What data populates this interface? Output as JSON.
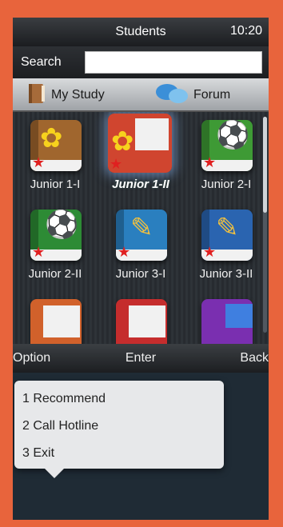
{
  "status": {
    "title": "Students",
    "time": "10:20"
  },
  "search": {
    "label": "Search",
    "value": ""
  },
  "tabs": [
    {
      "label": "My Study",
      "icon": "book-icon"
    },
    {
      "label": "Forum",
      "icon": "chat-bubbles-icon"
    }
  ],
  "courses": [
    {
      "label": "Junior 1-I",
      "icon": "flower-icon",
      "color": "#a0662e"
    },
    {
      "label": "Junior 1-II",
      "icon": "flower-notebook-icon",
      "color": "#d0452f",
      "selected": true
    },
    {
      "label": "Junior 2-I",
      "icon": "soccer-ball-icon",
      "color": "#3e9a35"
    },
    {
      "label": "Junior 2-II",
      "icon": "soccer-ball-icon",
      "color": "#2d8b35"
    },
    {
      "label": "Junior 3-I",
      "icon": "pencil-icon",
      "color": "#2a7fbf"
    },
    {
      "label": "Junior 3-II",
      "icon": "pencil-icon",
      "color": "#2a64b0"
    },
    {
      "label": "",
      "icon": "notebook-icon",
      "color": "#d1612b"
    },
    {
      "label": "",
      "icon": "notebook-icon",
      "color": "#c52d2d"
    },
    {
      "label": "",
      "icon": "notebook-icon",
      "color": "#7a2fb0"
    }
  ],
  "softkeys": {
    "left": "Option",
    "center": "Enter",
    "right": "Back"
  },
  "menu": [
    {
      "label": "1 Recommend"
    },
    {
      "label": "2 Call Hotline"
    },
    {
      "label": "3 Exit"
    }
  ]
}
